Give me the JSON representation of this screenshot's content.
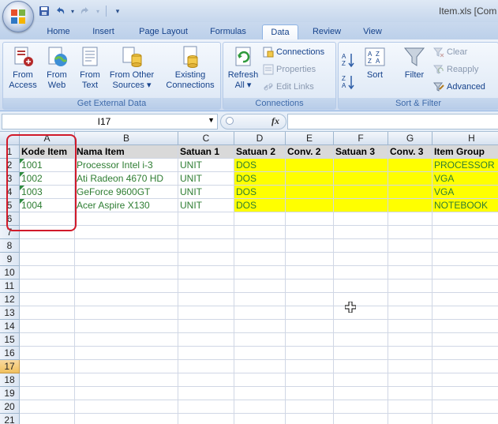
{
  "window": {
    "title": "Item.xls  [Com"
  },
  "tabs": [
    "Home",
    "Insert",
    "Page Layout",
    "Formulas",
    "Data",
    "Review",
    "View"
  ],
  "active_tab": "Data",
  "ribbon": {
    "get_external_data": {
      "label": "Get External Data",
      "buttons": [
        {
          "line1": "From",
          "line2": "Access",
          "icon": "access-db-icon"
        },
        {
          "line1": "From",
          "line2": "Web",
          "icon": "web-globe-icon"
        },
        {
          "line1": "From",
          "line2": "Text",
          "icon": "text-file-icon"
        },
        {
          "line1": "From Other",
          "line2": "Sources ▾",
          "icon": "other-sources-icon"
        },
        {
          "line1": "Existing",
          "line2": "Connections",
          "icon": "existing-connections-icon"
        }
      ]
    },
    "connections": {
      "label": "Connections",
      "refresh": {
        "line1": "Refresh",
        "line2": "All ▾"
      },
      "items": [
        "Connections",
        "Properties",
        "Edit Links"
      ]
    },
    "sort_filter": {
      "label": "Sort & Filter",
      "sort": "Sort",
      "filter": "Filter",
      "items": [
        "Clear",
        "Reapply",
        "Advanced"
      ],
      "sort_az": "A Z",
      "sort_za": "Z A"
    }
  },
  "formula_bar": {
    "name_box": "I17",
    "fx": "fx",
    "formula": ""
  },
  "columns": [
    "A",
    "B",
    "C",
    "D",
    "E",
    "F",
    "G",
    "H"
  ],
  "rows": [
    "1",
    "2",
    "3",
    "4",
    "5",
    "6",
    "7",
    "8",
    "9",
    "10",
    "11",
    "12",
    "13",
    "14",
    "15",
    "16",
    "17",
    "18",
    "19",
    "20",
    "21"
  ],
  "active_row": "17",
  "sheet": {
    "header": [
      "Kode Item",
      "Nama Item",
      "Satuan 1",
      "Satuan 2",
      "Conv. 2",
      "Satuan 3",
      "Conv. 3",
      "Item Group"
    ],
    "data": [
      [
        "1001",
        "Processor Intel i-3",
        "UNIT",
        "DOS",
        "",
        "",
        "",
        "PROCESSOR"
      ],
      [
        "1002",
        "Ati Radeon 4670 HD",
        "UNIT",
        "DOS",
        "",
        "",
        "",
        "VGA"
      ],
      [
        "1003",
        "GeForce 9600GT",
        "UNIT",
        "DOS",
        "",
        "",
        "",
        "VGA"
      ],
      [
        "1004",
        "Acer Aspire X130",
        "UNIT",
        "DOS",
        "",
        "",
        "",
        "NOTEBOOK"
      ]
    ]
  },
  "colors": {
    "highlight": "#ffff00",
    "text_green": "#2e7d32",
    "annotation_red": "#d11a2a",
    "header_grey": "#d9d9d9"
  }
}
